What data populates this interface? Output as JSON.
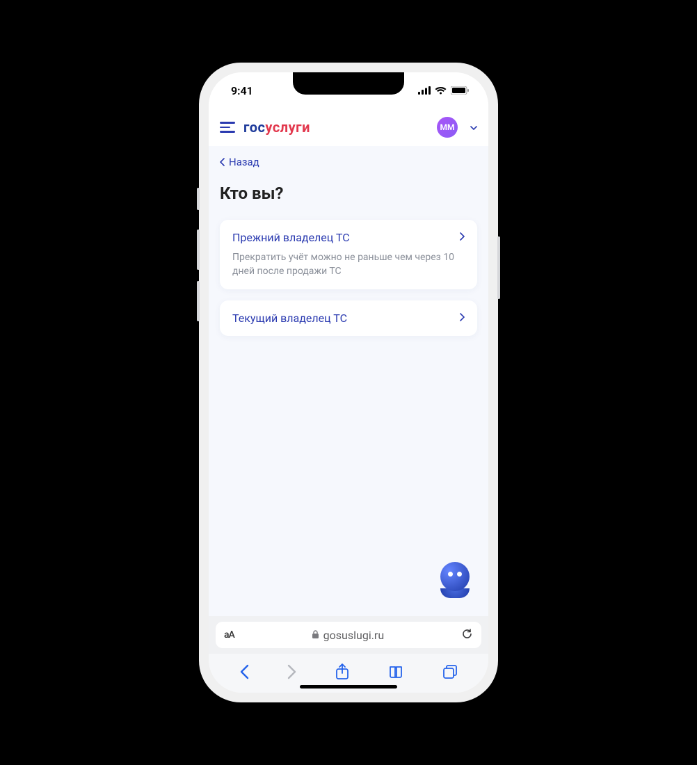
{
  "status": {
    "time": "9:41"
  },
  "header": {
    "logo_part1": "гос",
    "logo_part2": "услуги",
    "avatar_initials": "ММ"
  },
  "content": {
    "back_label": "Назад",
    "title": "Кто вы?",
    "options": [
      {
        "title": "Прежний владелец ТС",
        "subtitle": "Прекратить учёт можно не раньше чем через 10 дней после продажи ТС"
      },
      {
        "title": "Текущий владелец ТС",
        "subtitle": ""
      }
    ]
  },
  "browser": {
    "aa_label": "аА",
    "domain": "gosuslugi.ru"
  }
}
